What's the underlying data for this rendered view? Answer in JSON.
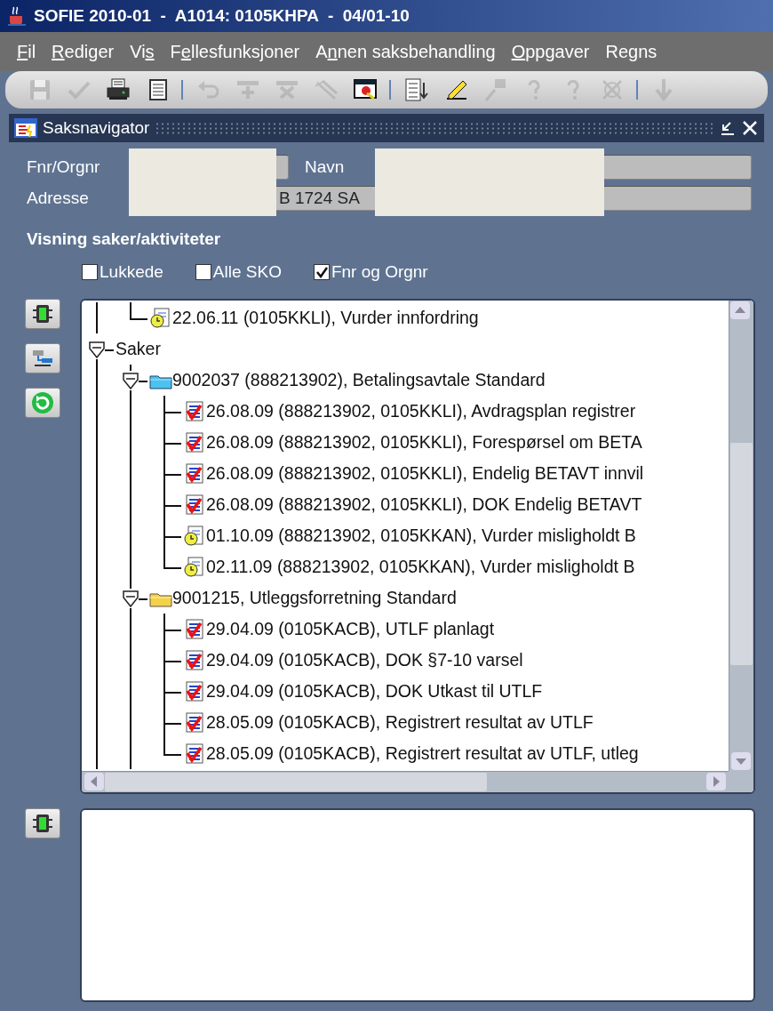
{
  "window": {
    "title": "SOFIE 2010-01  -  A1014: 0105KHPA  -  04/01-10"
  },
  "menu": [
    {
      "parts": [
        {
          "text": "F",
          "underlined": true
        },
        {
          "text": "il",
          "underlined": false
        }
      ]
    },
    {
      "parts": [
        {
          "text": "R",
          "underlined": true
        },
        {
          "text": "ediger",
          "underlined": false
        }
      ]
    },
    {
      "parts": [
        {
          "text": "Vi",
          "underlined": false
        },
        {
          "text": "s",
          "underlined": true
        }
      ]
    },
    {
      "parts": [
        {
          "text": "F",
          "underlined": false
        },
        {
          "text": "e",
          "underlined": true
        },
        {
          "text": "llesfunksjoner",
          "underlined": false
        }
      ]
    },
    {
      "parts": [
        {
          "text": "A",
          "underlined": false
        },
        {
          "text": "n",
          "underlined": true
        },
        {
          "text": "nen saksbehandling",
          "underlined": false
        }
      ]
    },
    {
      "parts": [
        {
          "text": "O",
          "underlined": true
        },
        {
          "text": "ppgaver",
          "underlined": false
        }
      ]
    },
    {
      "parts": [
        {
          "text": "Regns",
          "underlined": false
        }
      ]
    }
  ],
  "toolbar": [
    {
      "kind": "save",
      "disabled": true
    },
    {
      "kind": "check",
      "disabled": true
    },
    {
      "kind": "print",
      "disabled": false
    },
    {
      "kind": "list",
      "disabled": false
    },
    {
      "kind": "separator"
    },
    {
      "kind": "undo",
      "disabled": true
    },
    {
      "kind": "insert",
      "disabled": true
    },
    {
      "kind": "delete",
      "disabled": true
    },
    {
      "kind": "clear",
      "disabled": true
    },
    {
      "kind": "window",
      "disabled": false
    },
    {
      "kind": "separator"
    },
    {
      "kind": "sort",
      "disabled": false
    },
    {
      "kind": "edit",
      "disabled": false
    },
    {
      "kind": "tool",
      "disabled": true
    },
    {
      "kind": "help",
      "disabled": true
    },
    {
      "kind": "help",
      "disabled": true
    },
    {
      "kind": "cancel",
      "disabled": true
    },
    {
      "kind": "separator"
    },
    {
      "kind": "down",
      "disabled": true
    }
  ],
  "panel": {
    "title": "Saksnavigator"
  },
  "fields": {
    "fnr_label": "Fnr/Orgnr",
    "navn_label": "Navn",
    "adresse_label": "Adresse",
    "adresse_value": "B 1724 SA"
  },
  "filter": {
    "title": "Visning saker/aktiviteter",
    "options": [
      {
        "label": "Lukkede",
        "checked": false
      },
      {
        "label": "Alle SKO",
        "checked": false
      },
      {
        "label": "Fnr og Orgnr",
        "checked": true
      }
    ]
  },
  "tree": {
    "above": [
      {
        "kind": "task",
        "label": "22.06.11 (0105KKLI), Vurder innfordring"
      }
    ],
    "items": [
      {
        "label": "Saker",
        "expanded": true,
        "more_below": true,
        "children": [
          {
            "kind": "agreement",
            "label": "9002037 (888213902), Betalingsavtale Standard",
            "expanded": true,
            "children": [
              {
                "kind": "done",
                "label": "26.08.09 (888213902, 0105KKLI), Avdragsplan registrer"
              },
              {
                "kind": "done",
                "label": "26.08.09 (888213902, 0105KKLI), Forespørsel om BETA"
              },
              {
                "kind": "done",
                "label": "26.08.09 (888213902, 0105KKLI), Endelig BETAVT innvil"
              },
              {
                "kind": "done",
                "label": "26.08.09 (888213902, 0105KKLI), DOK Endelig BETAVT"
              },
              {
                "kind": "task",
                "label": "01.10.09 (888213902, 0105KKAN), Vurder misligholdt B"
              },
              {
                "kind": "task",
                "label": "02.11.09 (888213902, 0105KKAN), Vurder misligholdt B"
              }
            ]
          },
          {
            "kind": "folder",
            "label": "9001215, Utleggsforretning Standard",
            "expanded": true,
            "more_below": true,
            "children": [
              {
                "kind": "done",
                "label": "29.04.09 (0105KACB), UTLF planlagt"
              },
              {
                "kind": "done",
                "label": "29.04.09 (0105KACB), DOK §7-10 varsel"
              },
              {
                "kind": "done",
                "label": "29.04.09 (0105KACB), DOK Utkast til UTLF"
              },
              {
                "kind": "done",
                "label": "28.05.09 (0105KACB), Registrert resultat av UTLF"
              },
              {
                "kind": "done",
                "label": "28.05.09 (0105KACB), Registrert resultat av UTLF, utleg"
              }
            ]
          }
        ]
      }
    ]
  }
}
